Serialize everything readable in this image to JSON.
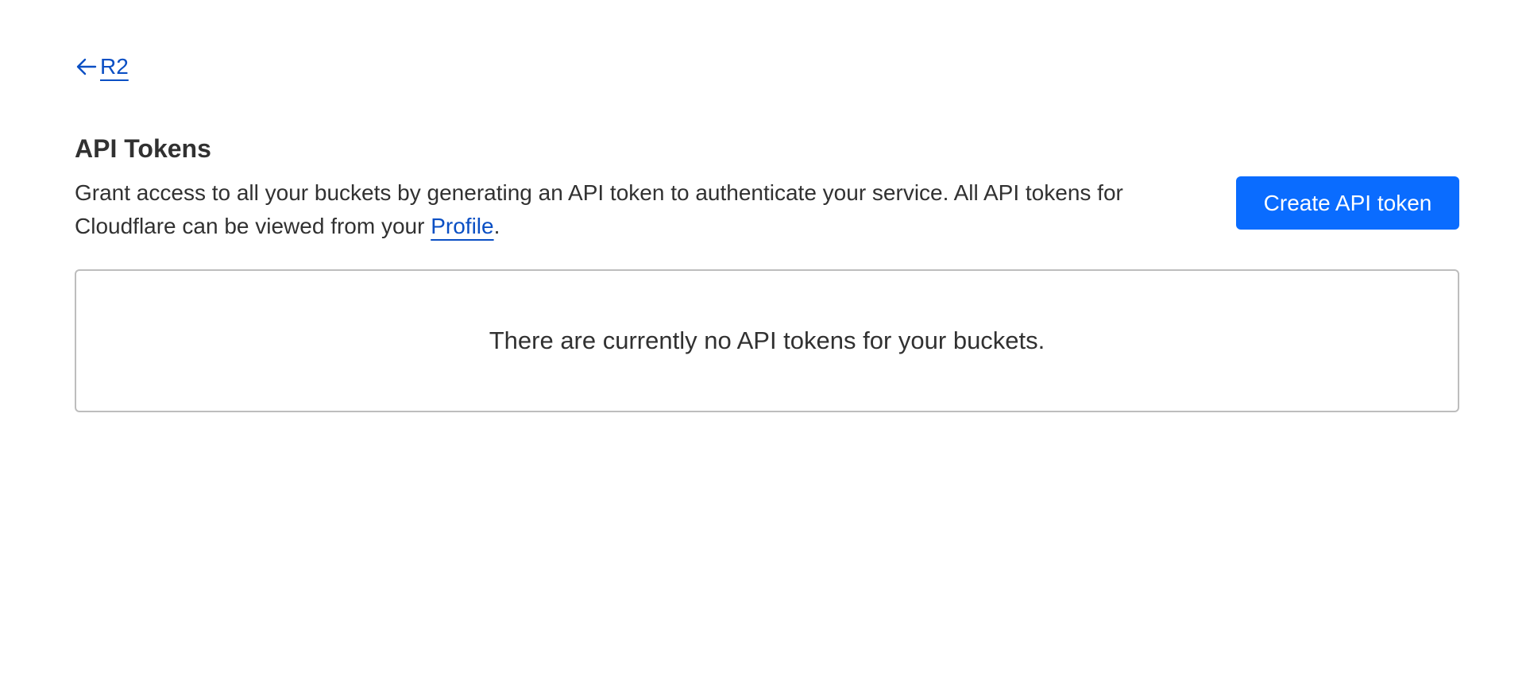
{
  "breadcrumb": {
    "back_label": "R2",
    "back_icon": "arrow-left-icon"
  },
  "header": {
    "title": "API Tokens"
  },
  "description": {
    "text_before": "Grant access to all your buckets by generating an API token to authenticate your service. All API tokens for Cloudflare can be viewed from your ",
    "link_label": "Profile",
    "text_after": "."
  },
  "actions": {
    "create_label": "Create API token"
  },
  "empty_state": {
    "message": "There are currently no API tokens for your buckets."
  },
  "colors": {
    "link": "#0a4fc4",
    "primary_button": "#0a6cff",
    "text": "#313131",
    "border": "#bdbdbd"
  }
}
